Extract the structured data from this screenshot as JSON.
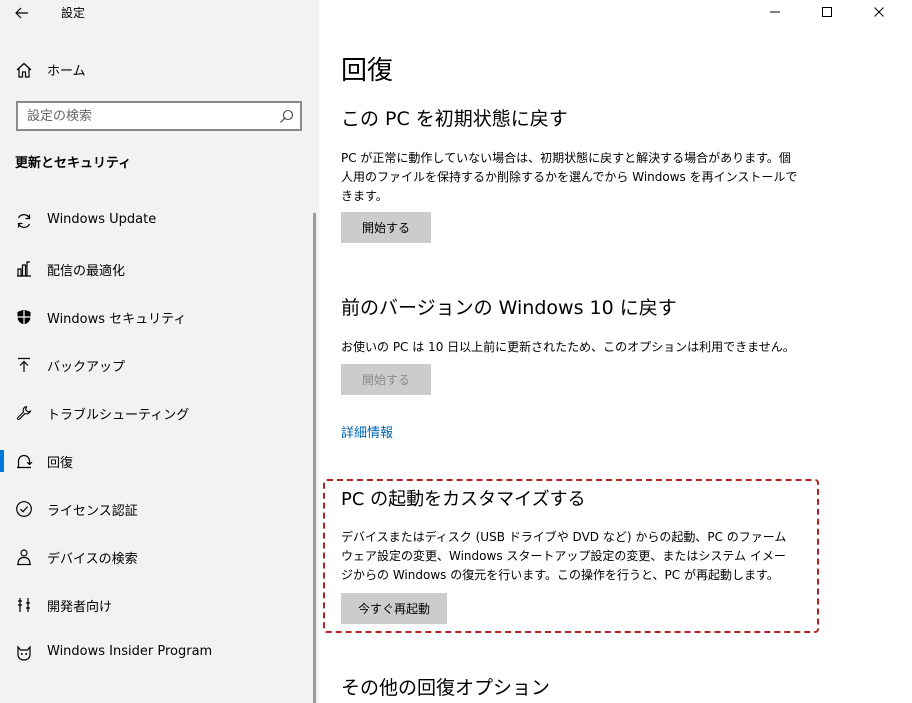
{
  "app": {
    "title": "設定"
  },
  "sidebar": {
    "home_label": "ホーム",
    "search_placeholder": "設定の検索",
    "section_title": "更新とセキュリティ",
    "items": [
      {
        "label": "Windows Update",
        "icon": "sync-icon"
      },
      {
        "label": "配信の最適化",
        "icon": "delivery-optimization-icon"
      },
      {
        "label": "Windows セキュリティ",
        "icon": "shield-icon"
      },
      {
        "label": "バックアップ",
        "icon": "backup-arrow-icon"
      },
      {
        "label": "トラブルシューティング",
        "icon": "wrench-icon"
      },
      {
        "label": "回復",
        "icon": "recovery-icon",
        "active": true
      },
      {
        "label": "ライセンス認証",
        "icon": "check-circle-icon"
      },
      {
        "label": "デバイスの検索",
        "icon": "person-location-icon"
      },
      {
        "label": "開発者向け",
        "icon": "developer-icon"
      },
      {
        "label": "Windows Insider Program",
        "icon": "insider-cat-icon"
      }
    ]
  },
  "main": {
    "page_title": "回復",
    "reset": {
      "heading": "この PC を初期状態に戻す",
      "description": "PC が正常に動作していない場合は、初期状態に戻すと解決する場合があります。個人用のファイルを保持するか削除するかを選んでから Windows を再インストールできます。",
      "button": "開始する"
    },
    "rollback": {
      "heading": "前のバージョンの Windows 10 に戻す",
      "description": "お使いの PC は 10 日以上前に更新されたため、このオプションは利用できません。",
      "button": "開始する",
      "link": "詳細情報"
    },
    "advanced": {
      "heading": "PC の起動をカスタマイズする",
      "description": "デバイスまたはディスク (USB ドライブや DVD など) からの起動、PC のファームウェア設定の変更、Windows スタートアップ設定の変更、またはシステム イメージからの Windows の復元を行います。この操作を行うと、PC が再起動します。",
      "button": "今すぐ再起動"
    },
    "more": {
      "heading": "その他の回復オプション"
    }
  },
  "colors": {
    "accent": "#0078d7",
    "highlight_frame": "#b22222",
    "link": "#0066b4"
  }
}
